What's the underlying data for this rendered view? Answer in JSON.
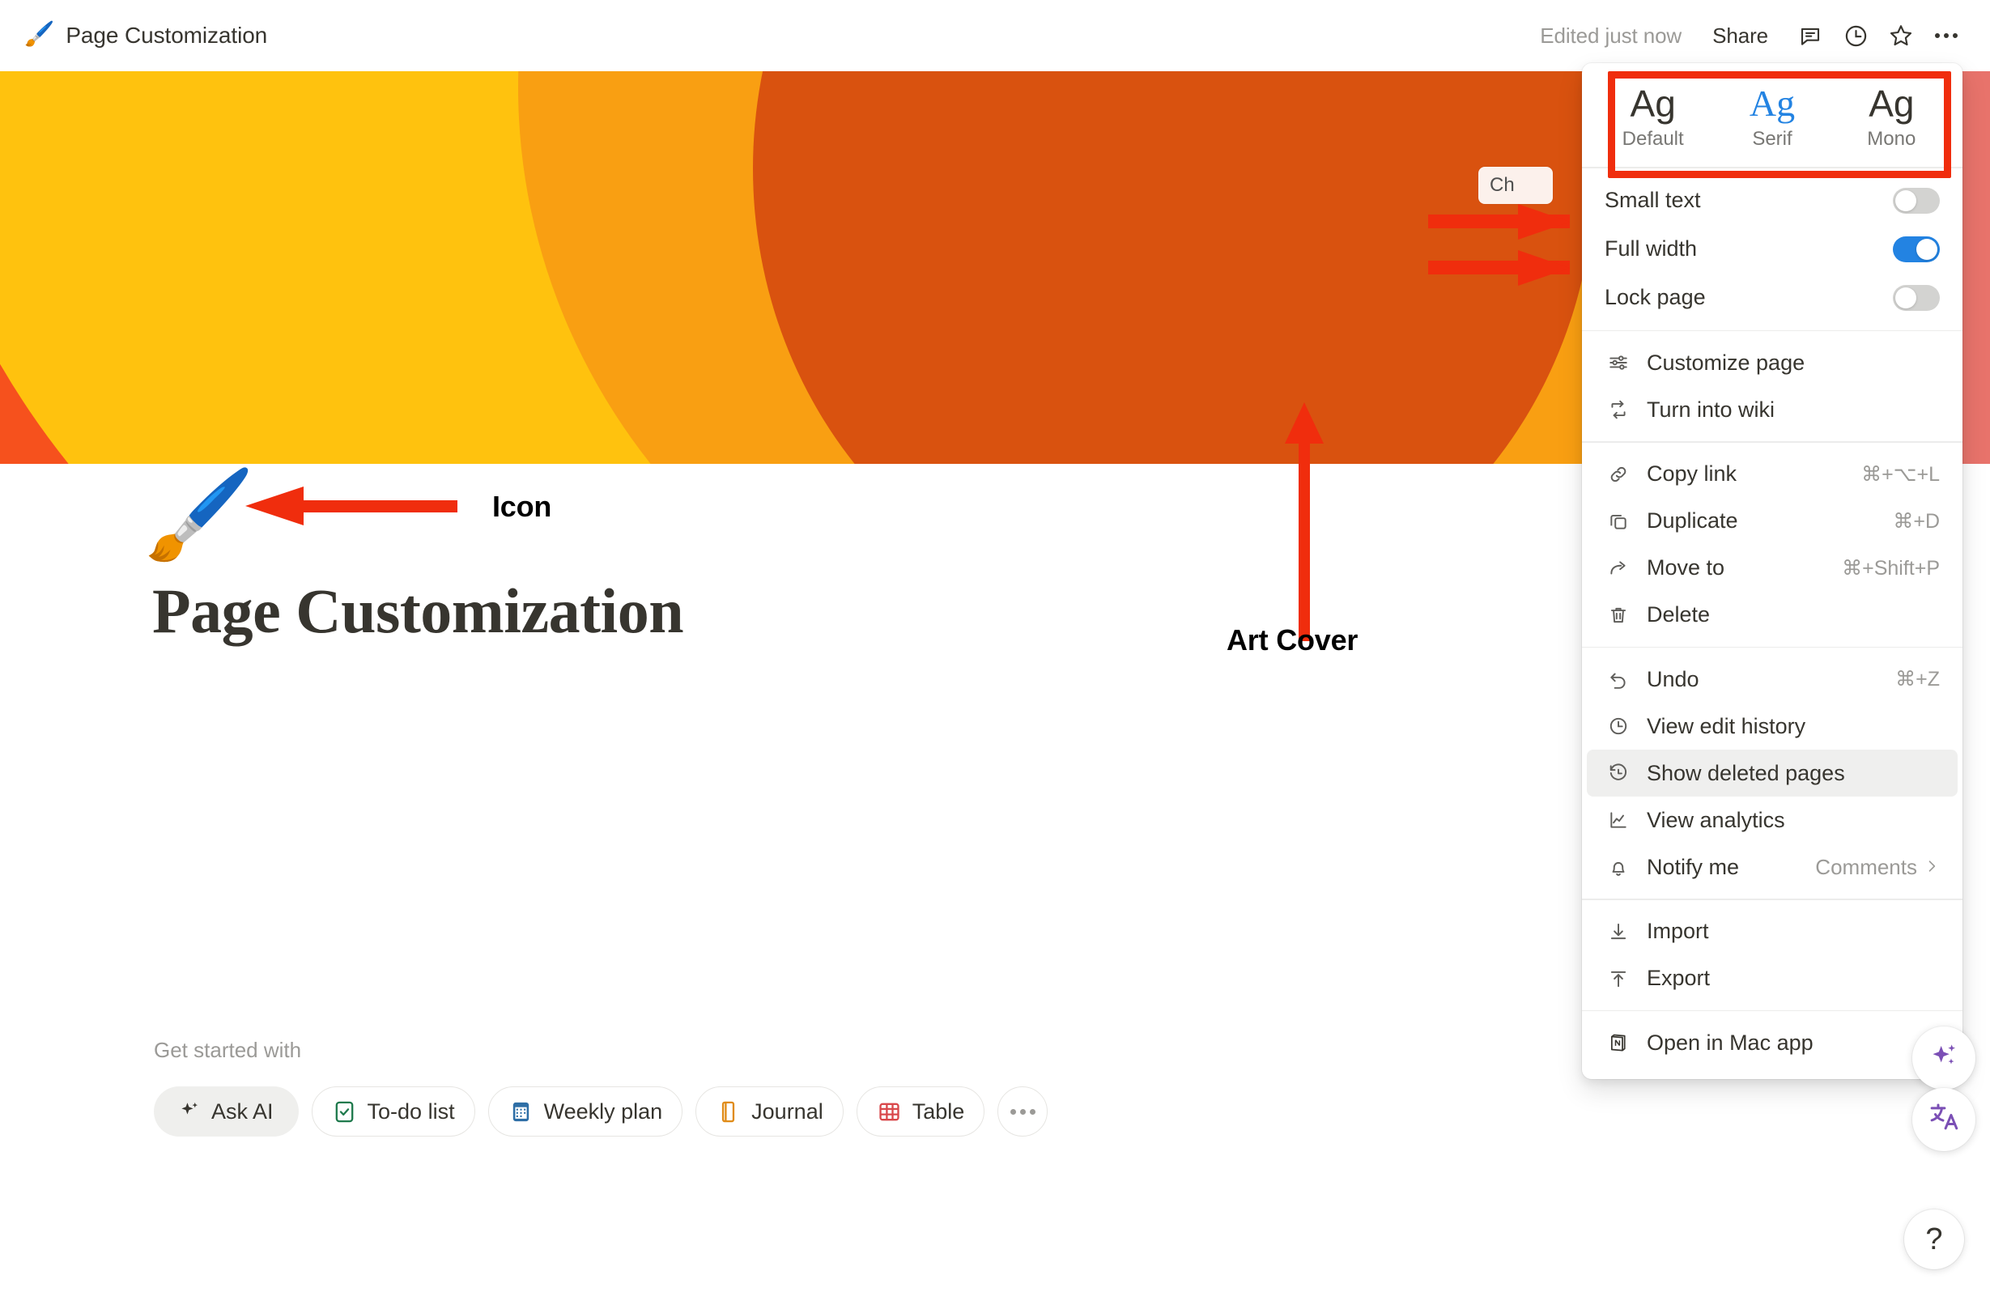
{
  "topbar": {
    "breadcrumb_emoji": "🖌️",
    "breadcrumb_title": "Page Customization",
    "edited_status": "Edited just now",
    "share_label": "Share",
    "icons": [
      "comment-icon",
      "history-icon",
      "star-icon",
      "more-options-icon"
    ]
  },
  "cover": {
    "change_cover_label": "Ch",
    "colors": [
      "#f05a23",
      "#f97d49",
      "#f8a3a0",
      "#e3ddd3",
      "#cdb007",
      "#f5a800",
      "#f99f12",
      "#ffc20e",
      "#d9520f",
      "#e8736b"
    ]
  },
  "page": {
    "icon_emoji": "🖌️",
    "title": "Page Customization",
    "get_started_label": "Get started with",
    "chips": [
      {
        "label": "Ask AI",
        "icon": "sparkle-icon",
        "highlighted": true
      },
      {
        "label": "To-do list",
        "icon": "checkbox-icon",
        "highlighted": false
      },
      {
        "label": "Weekly plan",
        "icon": "calendar-icon",
        "highlighted": false
      },
      {
        "label": "Journal",
        "icon": "book-icon",
        "highlighted": false
      },
      {
        "label": "Table",
        "icon": "table-icon",
        "highlighted": false
      }
    ],
    "chips_more": "more-options-icon"
  },
  "menu": {
    "fonts": [
      {
        "sample": "Ag",
        "name": "Default",
        "selected": false
      },
      {
        "sample": "Ag",
        "name": "Serif",
        "selected": true
      },
      {
        "sample": "Ag",
        "name": "Mono",
        "selected": false
      }
    ],
    "toggles": [
      {
        "label": "Small text",
        "on": false
      },
      {
        "label": "Full width",
        "on": true
      },
      {
        "label": "Lock page",
        "on": false
      }
    ],
    "group_page": [
      {
        "label": "Customize page",
        "icon": "sliders-icon",
        "shortcut": ""
      },
      {
        "label": "Turn into wiki",
        "icon": "turn-into-icon",
        "shortcut": ""
      }
    ],
    "group_actions": [
      {
        "label": "Copy link",
        "icon": "link-icon",
        "shortcut": "⌘+⌥+L"
      },
      {
        "label": "Duplicate",
        "icon": "duplicate-icon",
        "shortcut": "⌘+D"
      },
      {
        "label": "Move to",
        "icon": "move-to-icon",
        "shortcut": "⌘+Shift+P"
      },
      {
        "label": "Delete",
        "icon": "trash-icon",
        "shortcut": ""
      }
    ],
    "group_history": [
      {
        "label": "Undo",
        "icon": "undo-icon",
        "shortcut": "⌘+Z",
        "active": false,
        "value": ""
      },
      {
        "label": "View edit history",
        "icon": "clock-icon",
        "shortcut": "",
        "active": false,
        "value": ""
      },
      {
        "label": "Show deleted pages",
        "icon": "restore-icon",
        "shortcut": "",
        "active": true,
        "value": ""
      },
      {
        "label": "View analytics",
        "icon": "analytics-icon",
        "shortcut": "",
        "active": false,
        "value": ""
      },
      {
        "label": "Notify me",
        "icon": "bell-icon",
        "shortcut": "",
        "active": false,
        "value": "Comments"
      }
    ],
    "group_io": [
      {
        "label": "Import",
        "icon": "import-icon",
        "shortcut": ""
      },
      {
        "label": "Export",
        "icon": "export-icon",
        "shortcut": ""
      }
    ],
    "group_app": [
      {
        "label": "Open in Mac app",
        "icon": "notion-logo-icon",
        "shortcut": ""
      }
    ]
  },
  "annotations": {
    "accent_color": "#f02d0d",
    "icon_label": "Icon",
    "art_cover_label": "Art Cover",
    "highlight_target": "font-style-selector",
    "arrow_targets": [
      "Small text",
      "Full width"
    ]
  },
  "floating": {
    "ai_icon": "sparkle-icon",
    "translate_icon": "translate-icon",
    "help_label": "?"
  }
}
